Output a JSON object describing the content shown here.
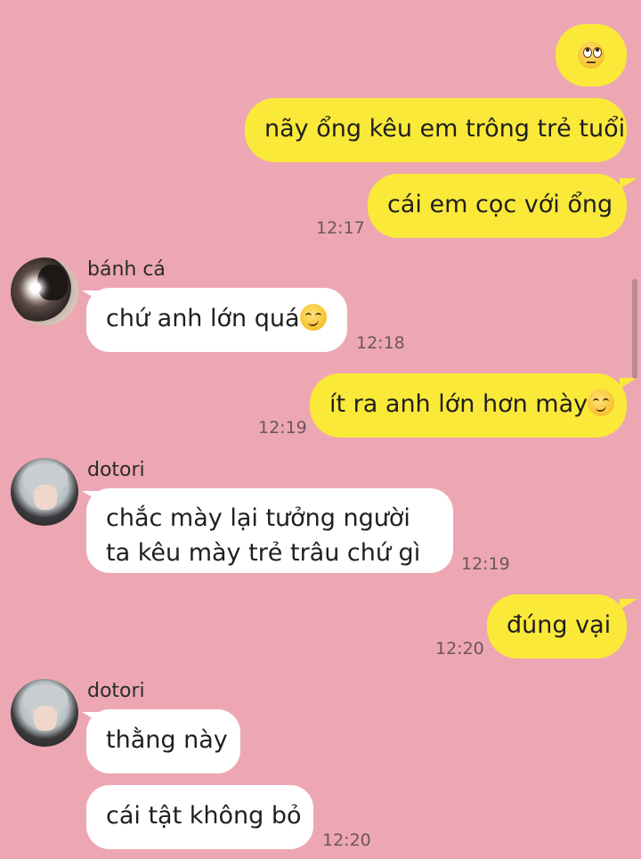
{
  "colors": {
    "background": "#eda7b2",
    "my_bubble": "#fbe93a",
    "their_bubble": "#ffffff"
  },
  "messages": {
    "m1": {
      "emoji": "face-with-rolling-eyes"
    },
    "m2": {
      "text": "nãy ổng kêu em trông trẻ tuổi"
    },
    "m3": {
      "text": "cái em cọc với ổng",
      "time": "12:17"
    },
    "m4": {
      "sender": "bánh cá",
      "text": "chứ anh lớn quá",
      "emoji": "smirking-face",
      "time": "12:18"
    },
    "m5": {
      "text": "ít ra anh lớn hơn mày",
      "emoji": "smirking-face",
      "time": "12:19"
    },
    "m6": {
      "sender": "dotori",
      "text": "chắc mày lại tưởng người ta kêu mày trẻ trâu chứ gì",
      "time": "12:19"
    },
    "m7": {
      "text": "đúng vại",
      "time": "12:20"
    },
    "m8": {
      "sender": "dotori",
      "text": "thằng này"
    },
    "m9": {
      "text": "cái tật không bỏ",
      "time": "12:20"
    }
  }
}
